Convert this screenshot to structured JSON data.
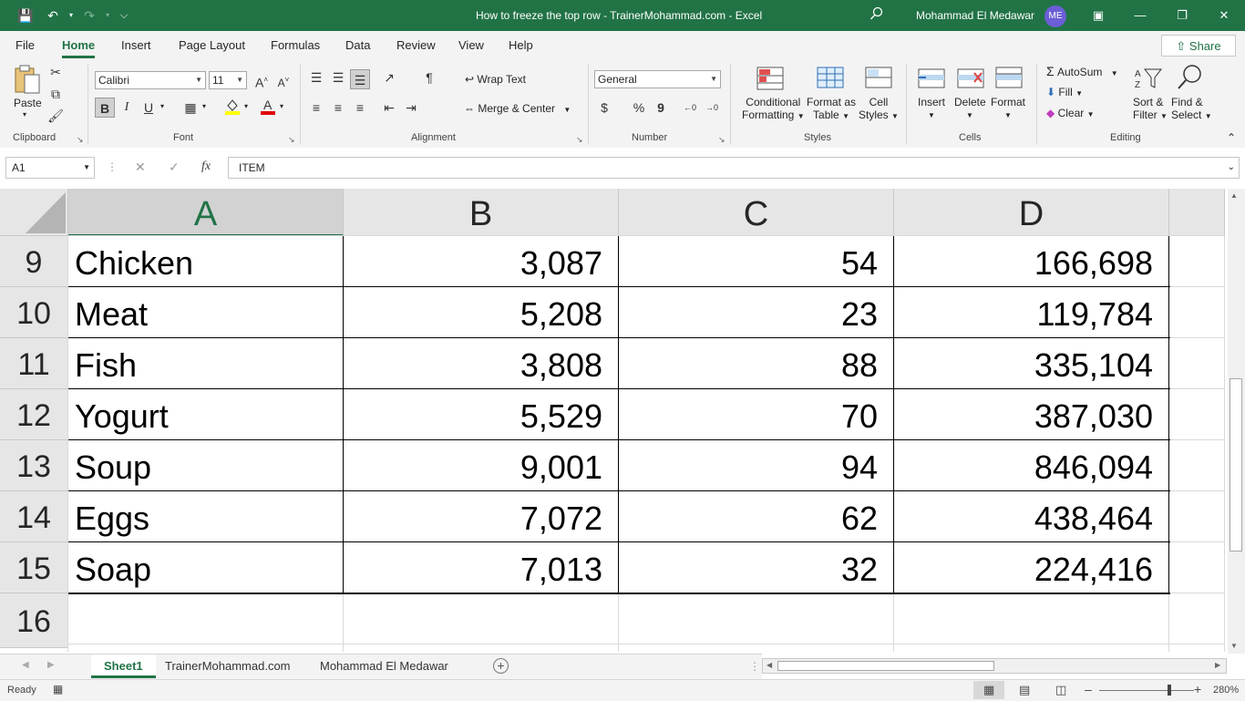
{
  "window": {
    "title": "How to freeze the top row - TrainerMohammad.com  -  Excel",
    "user": "Mohammad El Medawar",
    "initials": "ME"
  },
  "menu": {
    "tabs": [
      "File",
      "Home",
      "Insert",
      "Page Layout",
      "Formulas",
      "Data",
      "Review",
      "View",
      "Help"
    ],
    "active": "Home",
    "share": "Share"
  },
  "ribbon": {
    "clipboard": {
      "paste": "Paste",
      "label": "Clipboard"
    },
    "font": {
      "name": "Calibri",
      "size": "11",
      "label": "Font",
      "bold": "B",
      "italic": "I",
      "underline": "U"
    },
    "alignment": {
      "wrap": "Wrap Text",
      "merge": "Merge & Center",
      "label": "Alignment"
    },
    "number": {
      "format": "General",
      "label": "Number",
      "currency": "$",
      "percent": "%",
      "comma": "9"
    },
    "styles": {
      "conditional_1": "Conditional",
      "conditional_2": "Formatting",
      "table_1": "Format as",
      "table_2": "Table",
      "cell_1": "Cell",
      "cell_2": "Styles",
      "label": "Styles"
    },
    "cells": {
      "insert": "Insert",
      "delete": "Delete",
      "format": "Format",
      "label": "Cells"
    },
    "editing": {
      "autosum": "AutoSum",
      "fill": "Fill",
      "clear": "Clear",
      "sort_1": "Sort &",
      "sort_2": "Filter",
      "find_1": "Find &",
      "find_2": "Select",
      "label": "Editing"
    }
  },
  "formula_bar": {
    "name_box": "A1",
    "fx": "fx",
    "content": "ITEM"
  },
  "sheet": {
    "columns": [
      "A",
      "B",
      "C",
      "D"
    ],
    "selected_column": "A",
    "rows": [
      {
        "row": "9",
        "a": "Chicken",
        "b": "3,087",
        "c": "54",
        "d": "166,698"
      },
      {
        "row": "10",
        "a": "Meat",
        "b": "5,208",
        "c": "23",
        "d": "119,784"
      },
      {
        "row": "11",
        "a": "Fish",
        "b": "3,808",
        "c": "88",
        "d": "335,104"
      },
      {
        "row": "12",
        "a": "Yogurt",
        "b": "5,529",
        "c": "70",
        "d": "387,030"
      },
      {
        "row": "13",
        "a": "Soup",
        "b": "9,001",
        "c": "94",
        "d": "846,094"
      },
      {
        "row": "14",
        "a": "Eggs",
        "b": "7,072",
        "c": "62",
        "d": "438,464"
      },
      {
        "row": "15",
        "a": "Soap",
        "b": "7,013",
        "c": "32",
        "d": "224,416"
      },
      {
        "row": "16",
        "a": "",
        "b": "",
        "c": "",
        "d": ""
      }
    ]
  },
  "sheet_tabs": [
    "Sheet1",
    "TrainerMohammad.com",
    "Mohammad El Medawar"
  ],
  "active_sheet": "Sheet1",
  "status": {
    "ready": "Ready",
    "zoom": "280%"
  },
  "colors": {
    "accent": "#217346",
    "avatar": "#6b5ed6"
  }
}
